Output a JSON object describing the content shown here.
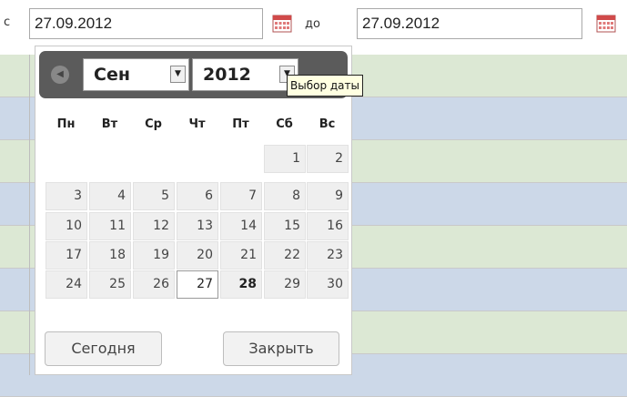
{
  "filter": {
    "from_label": "с",
    "from_value": "27.09.2012",
    "to_label": "до",
    "to_value": "27.09.2012"
  },
  "colors": {
    "row_green": "#dce8d4",
    "row_blue": "#ccd8e8",
    "header_bar": "#5b5b5b",
    "tooltip_bg": "#ffffe1"
  },
  "datepicker": {
    "month": "Сен",
    "year": "2012",
    "tooltip": "Выбор даты",
    "weekdays": [
      "Пн",
      "Вт",
      "Ср",
      "Чт",
      "Пт",
      "Сб",
      "Вс"
    ],
    "weeks": [
      [
        "",
        "",
        "",
        "",
        "",
        "1",
        "2"
      ],
      [
        "3",
        "4",
        "5",
        "6",
        "7",
        "8",
        "9"
      ],
      [
        "10",
        "11",
        "12",
        "13",
        "14",
        "15",
        "16"
      ],
      [
        "17",
        "18",
        "19",
        "20",
        "21",
        "22",
        "23"
      ],
      [
        "24",
        "25",
        "26",
        "27",
        "28",
        "29",
        "30"
      ]
    ],
    "today_label": "Сегодня",
    "close_label": "Закрыть"
  }
}
